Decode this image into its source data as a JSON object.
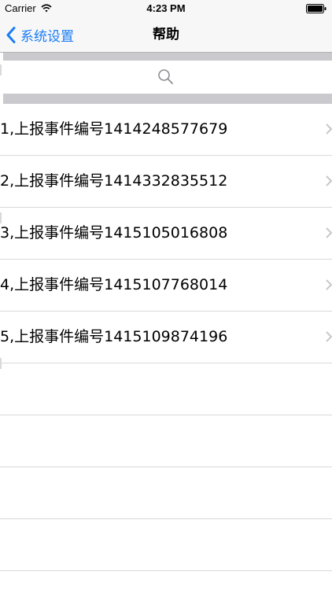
{
  "status_bar": {
    "carrier": "Carrier",
    "time": "4:23 PM"
  },
  "nav_bar": {
    "back_label": "系统设置",
    "title": "帮助"
  },
  "colors": {
    "accent": "#1a7cf5",
    "separator": "#d9d9d9",
    "search_strip": "#c9c9ce"
  },
  "icons": {
    "back": "chevron-left-icon",
    "search": "search-icon",
    "row_disclosure": "chevron-right-icon"
  },
  "list": {
    "items": [
      {
        "label": "1,上报事件编号1414248577679"
      },
      {
        "label": "2,上报事件编号1414332835512"
      },
      {
        "label": "3,上报事件编号1415105016808"
      },
      {
        "label": "4,上报事件编号1415107768014"
      },
      {
        "label": "5,上报事件编号1415109874196"
      }
    ]
  }
}
